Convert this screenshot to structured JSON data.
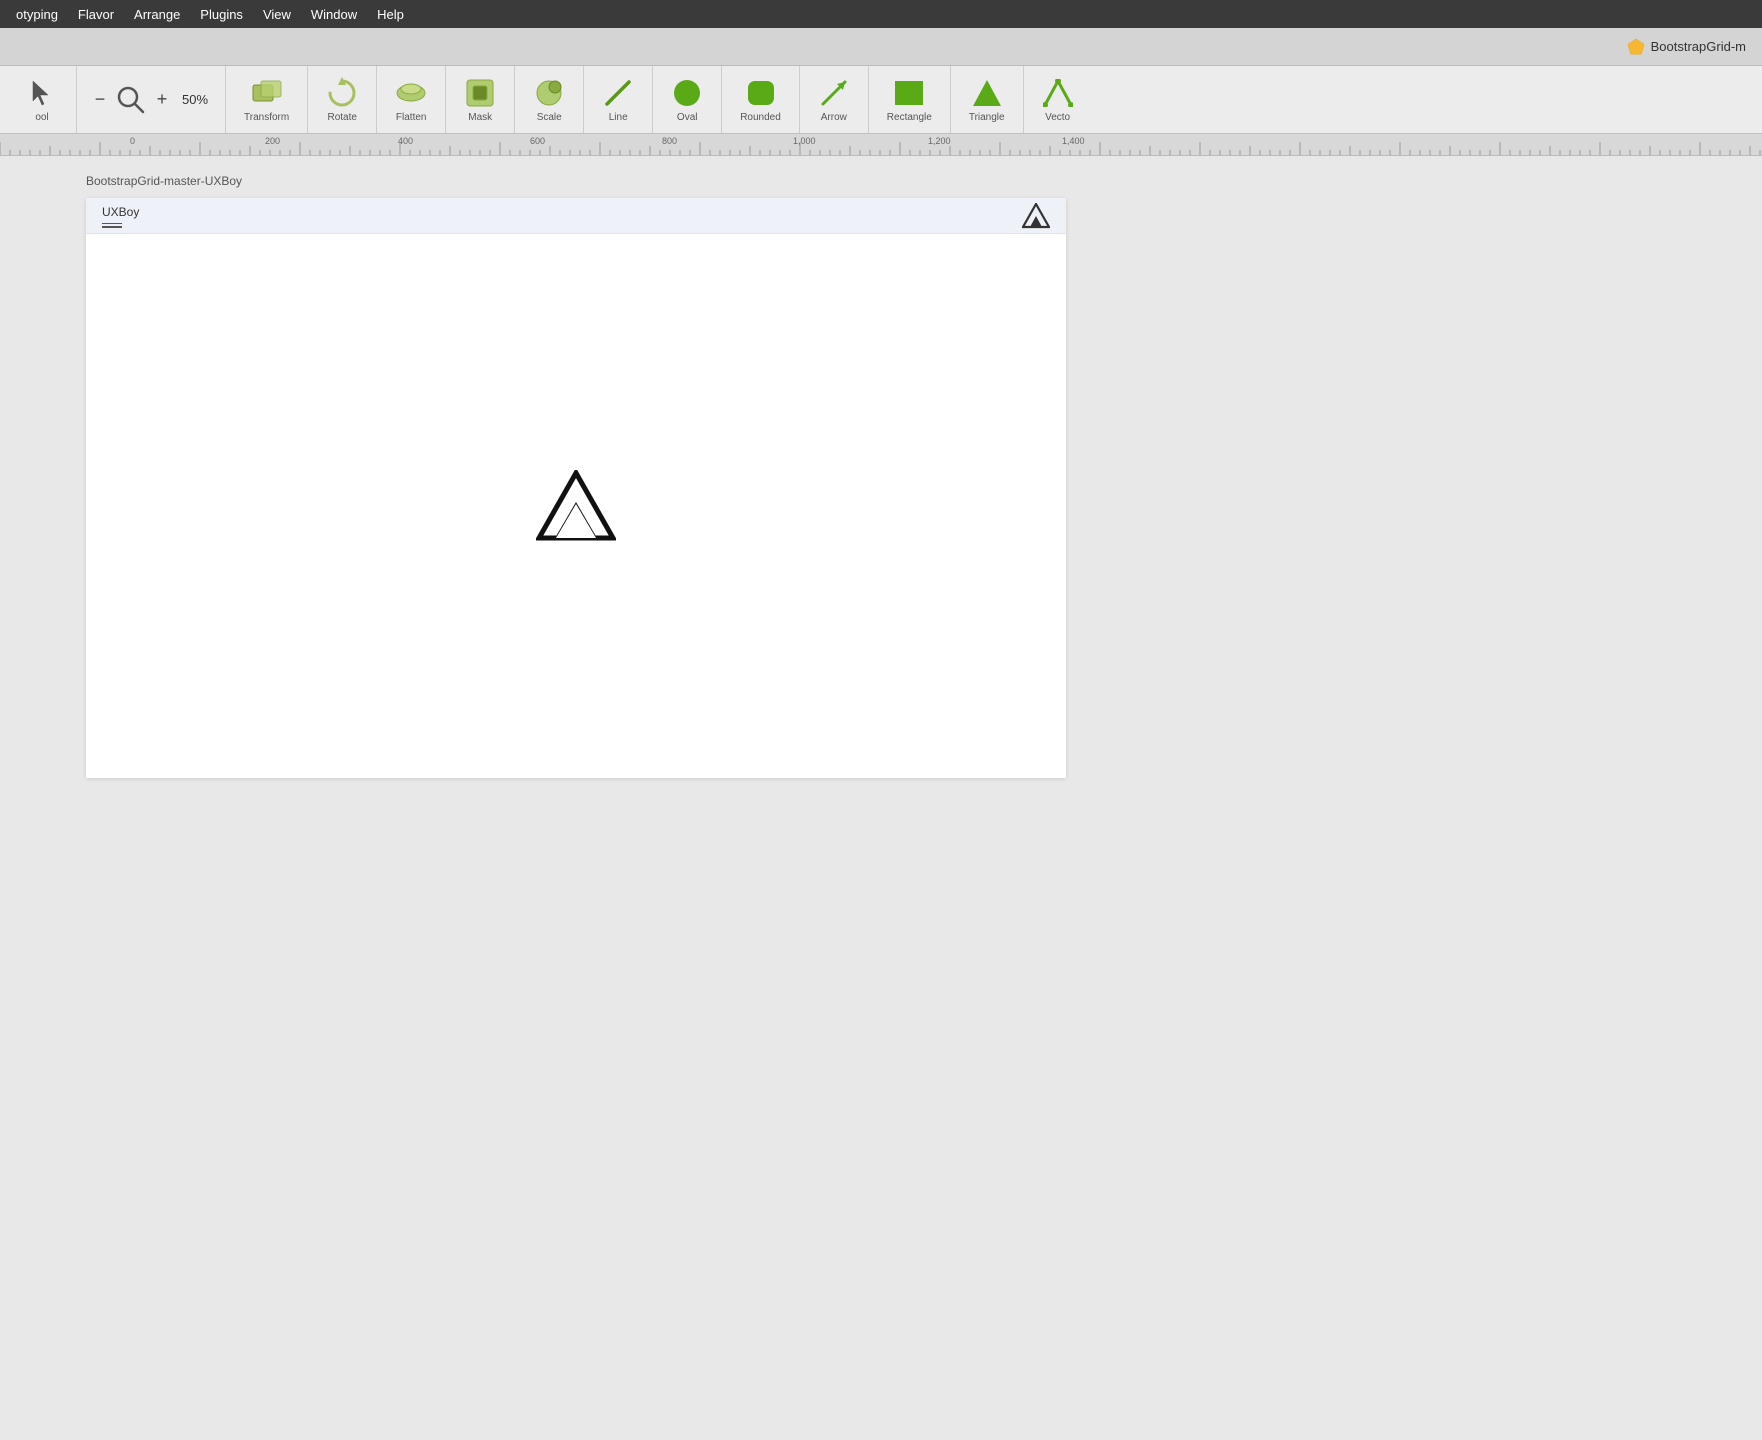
{
  "menubar": {
    "items": [
      {
        "label": "otyping"
      },
      {
        "label": "Flavor"
      },
      {
        "label": "Arrange"
      },
      {
        "label": "Plugins"
      },
      {
        "label": "View"
      },
      {
        "label": "Window"
      },
      {
        "label": "Help"
      }
    ]
  },
  "titlebar": {
    "title": "BootstrapGrid-m"
  },
  "toolbar": {
    "zoom_minus": "−",
    "zoom_value": "50%",
    "zoom_plus": "+",
    "tools": [
      {
        "id": "tool",
        "label": "ool"
      },
      {
        "id": "transform",
        "label": "Transform"
      },
      {
        "id": "rotate",
        "label": "Rotate"
      },
      {
        "id": "flatten",
        "label": "Flatten"
      },
      {
        "id": "mask",
        "label": "Mask"
      },
      {
        "id": "scale",
        "label": "Scale"
      },
      {
        "id": "line",
        "label": "Line"
      },
      {
        "id": "oval",
        "label": "Oval"
      },
      {
        "id": "rounded",
        "label": "Rounded"
      },
      {
        "id": "arrow",
        "label": "Arrow"
      },
      {
        "id": "rectangle",
        "label": "Rectangle"
      },
      {
        "id": "triangle",
        "label": "Triangle"
      },
      {
        "id": "vector",
        "label": "Vecto"
      }
    ]
  },
  "ruler": {
    "labels": [
      {
        "value": "0",
        "offset": 130
      },
      {
        "value": "200",
        "offset": 270
      },
      {
        "value": "400",
        "offset": 402
      },
      {
        "value": "600",
        "offset": 534
      },
      {
        "value": "800",
        "offset": 666
      },
      {
        "value": "1,000",
        "offset": 800
      },
      {
        "value": "1,200",
        "offset": 938
      },
      {
        "value": "1,400",
        "offset": 1070
      }
    ]
  },
  "canvas": {
    "artboard_label": "BootstrapGrid-master-UXBoy",
    "artboard": {
      "header_title": "UXBoy",
      "header_underline": true
    }
  },
  "colors": {
    "toolbar_bg": "#ececec",
    "menubar_bg": "#3a3a3a",
    "canvas_bg": "#e8e8e8",
    "artboard_header_bg": "#eef2f8",
    "shape_green": "#6aaa20",
    "shape_light_green": "#a8c060"
  }
}
